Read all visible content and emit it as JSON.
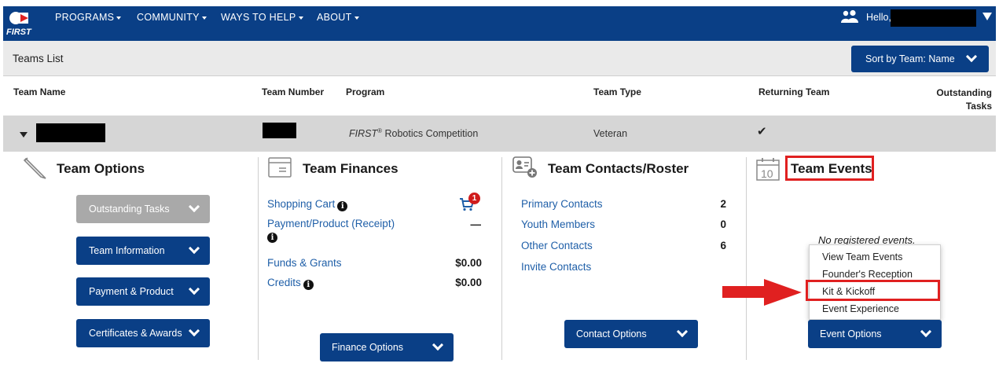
{
  "nav": {
    "brand": "FIRST",
    "items": [
      "PROGRAMS",
      "COMMUNITY",
      "WAYS TO HELP",
      "ABOUT"
    ],
    "greeting": "Hello, B"
  },
  "list": {
    "title": "Teams List",
    "sort_label": "Sort by Team: Name"
  },
  "columns": {
    "team_name": "Team Name",
    "team_number": "Team Number",
    "program": "Program",
    "team_type": "Team Type",
    "returning_team": "Returning Team",
    "outstanding_line1": "Outstanding",
    "outstanding_line2": "Tasks"
  },
  "team_row": {
    "program_italic": "FIRST",
    "program_reg": "®",
    "program_rest": " Robotics Competition",
    "team_type": "Veteran",
    "returning": "✔"
  },
  "team_options": {
    "title": "Team Options",
    "buttons": [
      "Outstanding Tasks",
      "Team Information",
      "Payment & Product",
      "Certificates & Awards"
    ]
  },
  "team_finances": {
    "title": "Team Finances",
    "shopping_cart": "Shopping Cart",
    "cart_badge": "1",
    "payment_label": "Payment/Product (Receipt)",
    "payment_value": "—",
    "funds_label": "Funds & Grants",
    "funds_value": "$0.00",
    "credits_label": "Credits",
    "credits_value": "$0.00",
    "button": "Finance Options"
  },
  "team_contacts": {
    "title": "Team Contacts/Roster",
    "rows": [
      {
        "label": "Primary Contacts",
        "value": "2"
      },
      {
        "label": "Youth Members",
        "value": "0"
      },
      {
        "label": "Other Contacts",
        "value": "6"
      }
    ],
    "invite": "Invite Contacts",
    "button": "Contact Options"
  },
  "team_events": {
    "title": "Team Events",
    "calendar_day": "10",
    "empty_message": "No registered events.",
    "menu": [
      "View Team Events",
      "Founder's Reception",
      "Kit & Kickoff",
      "Event Experience"
    ],
    "button": "Event Options"
  },
  "colors": {
    "nav_blue": "#0a3f86",
    "link_blue": "#1f5fa8",
    "highlight_red": "#e02020",
    "disabled_gray": "#a9a9a9"
  }
}
